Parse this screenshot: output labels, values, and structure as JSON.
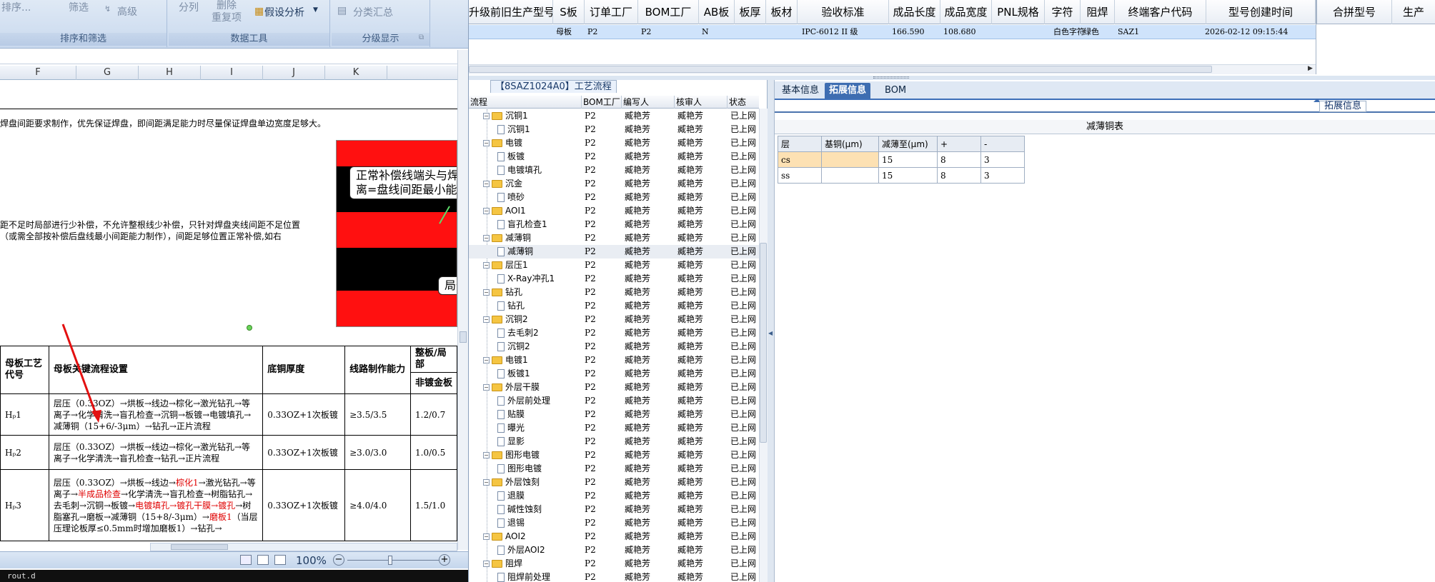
{
  "ribbon": {
    "sort_label": "排序...",
    "filter_label": "筛选",
    "advanced_label": "高级",
    "group_sort_filter": "排序和筛选",
    "split_label": "分列",
    "remove_dup_label": "删除\n重复项",
    "whatif_label": "假设分析",
    "group_data_tools": "数据工具",
    "subtotal_label": "分类汇总",
    "group_outline": "分级显示"
  },
  "sheet": {
    "columns": [
      "F",
      "G",
      "H",
      "I",
      "J",
      "K"
    ],
    "line1": "焊盘间距要求制作，优先保证焊盘，即间距满足能力时尽量保证焊盘单边宽度足够大。",
    "line2": "距不足时局部进行少补偿，不允许整根线少补偿，只针对焊盘夹线间距不足位置",
    "line3": "（或需全部按补偿后盘线最小间距能力制作），间距足够位置正常补偿,如右",
    "callout1a": "正常补偿线端头与焊",
    "callout1b": "离=盘线间距最小能",
    "callout2": "局部",
    "zoom": "100%",
    "taskbar_text": "rout.d",
    "table": {
      "headers": [
        "母板工艺\n代号",
        "母板关键流程设置",
        "底铜厚度",
        "线路制作能力",
        "整板/局部"
      ],
      "subheader": "非镀金板",
      "rows": [
        {
          "code": "Hₚ1",
          "flow": "层压（0.33OZ）→烘板→线边→棕化→激光钻孔→等离子→化学清洗→盲孔检查→沉铜→板镀→电镀填孔→减薄铜（15+6/-3μm）→钻孔→正片流程",
          "copper": "0.33OZ+1次板镀",
          "ability": "≥3.5/3.5",
          "ratio": "1.2/0.7"
        },
        {
          "code": "Hₚ2",
          "flow": "层压（0.33OZ）→烘板→线边→棕化→激光钻孔→等离子→化学清洗→盲孔检查→钻孔→正片流程",
          "copper": "0.33OZ+1次板镀",
          "ability": "≥3.0/3.0",
          "ratio": "1.0/0.5"
        },
        {
          "code": "Hₚ3",
          "flow_a": "层压（0.33OZ）→烘板→线边→",
          "flow_red1": "棕化1",
          "flow_b": "→激光钻孔→等离子→",
          "flow_red2": "半成品检查",
          "flow_c": "→化学清洗→盲孔检查→树脂钻孔→去毛刺→沉铜→板镀→",
          "flow_red3": "电镀填孔→镀孔干膜→镀孔",
          "flow_d": "→树脂塞孔→磨板→减薄铜（15+8/-3μm）→",
          "flow_red4": "磨板1",
          "flow_e": "（当层压理论板厚≤0.5mm时增加磨板1）→钻孔→",
          "copper": "0.33OZ+1次板镀",
          "ability": "≥4.0/4.0",
          "ratio": "1.5/1.0"
        }
      ]
    }
  },
  "grid": {
    "columns": [
      "升级前旧生产型号",
      "S板",
      "订单工厂",
      "BOM工厂",
      "AB板",
      "板厚",
      "板材",
      "验收标准",
      "成品长度",
      "成品宽度",
      "PNL规格",
      "字符",
      "阻焊",
      "终端客户代码",
      "型号创建时间",
      "合拼型号",
      "生产"
    ],
    "row": {
      "s": "母板",
      "order_factory": "P2",
      "bom_factory": "P2",
      "ab": "N",
      "standard": "IPC-6012 II 级",
      "length": "166.590",
      "width": "108.680",
      "char": "白色字符",
      "mask": "绿色",
      "customer": "SAZ1",
      "created": "2026-02-12 09:15:44"
    }
  },
  "process": {
    "title": "【8SAZ1024A0】工艺流程",
    "headers": [
      "流程",
      "BOM工厂",
      "编写人",
      "核审人",
      "状态"
    ],
    "rows": [
      {
        "lvl": 0,
        "name": "沉铜1",
        "bom": "P2",
        "w": "臧艳芳",
        "r": "臧艳芳",
        "s": "已上网"
      },
      {
        "lvl": 1,
        "name": "沉铜1",
        "bom": "P2",
        "w": "臧艳芳",
        "r": "臧艳芳",
        "s": "已上网"
      },
      {
        "lvl": 0,
        "name": "电镀",
        "bom": "P2",
        "w": "臧艳芳",
        "r": "臧艳芳",
        "s": "已上网"
      },
      {
        "lvl": 1,
        "name": "板镀",
        "bom": "P2",
        "w": "臧艳芳",
        "r": "臧艳芳",
        "s": "已上网"
      },
      {
        "lvl": 1,
        "name": "电镀填孔",
        "bom": "P2",
        "w": "臧艳芳",
        "r": "臧艳芳",
        "s": "已上网"
      },
      {
        "lvl": 0,
        "name": "沉金",
        "bom": "P2",
        "w": "臧艳芳",
        "r": "臧艳芳",
        "s": "已上网"
      },
      {
        "lvl": 1,
        "name": "喷砂",
        "bom": "P2",
        "w": "臧艳芳",
        "r": "臧艳芳",
        "s": "已上网"
      },
      {
        "lvl": 0,
        "name": "AOI1",
        "bom": "P2",
        "w": "臧艳芳",
        "r": "臧艳芳",
        "s": "已上网"
      },
      {
        "lvl": 1,
        "name": "盲孔检查1",
        "bom": "P2",
        "w": "臧艳芳",
        "r": "臧艳芳",
        "s": "已上网"
      },
      {
        "lvl": 0,
        "name": "减薄铜",
        "bom": "P2",
        "w": "臧艳芳",
        "r": "臧艳芳",
        "s": "已上网"
      },
      {
        "lvl": 1,
        "name": "减薄铜",
        "bom": "P2",
        "w": "臧艳芳",
        "r": "臧艳芳",
        "s": "已上网",
        "sel": true
      },
      {
        "lvl": 0,
        "name": "层压1",
        "bom": "P2",
        "w": "臧艳芳",
        "r": "臧艳芳",
        "s": "已上网"
      },
      {
        "lvl": 1,
        "name": "X-Ray冲孔1",
        "bom": "P2",
        "w": "臧艳芳",
        "r": "臧艳芳",
        "s": "已上网"
      },
      {
        "lvl": 0,
        "name": "钻孔",
        "bom": "P2",
        "w": "臧艳芳",
        "r": "臧艳芳",
        "s": "已上网"
      },
      {
        "lvl": 1,
        "name": "钻孔",
        "bom": "P2",
        "w": "臧艳芳",
        "r": "臧艳芳",
        "s": "已上网"
      },
      {
        "lvl": 0,
        "name": "沉铜2",
        "bom": "P2",
        "w": "臧艳芳",
        "r": "臧艳芳",
        "s": "已上网"
      },
      {
        "lvl": 1,
        "name": "去毛刺2",
        "bom": "P2",
        "w": "臧艳芳",
        "r": "臧艳芳",
        "s": "已上网"
      },
      {
        "lvl": 1,
        "name": "沉铜2",
        "bom": "P2",
        "w": "臧艳芳",
        "r": "臧艳芳",
        "s": "已上网"
      },
      {
        "lvl": 0,
        "name": "电镀1",
        "bom": "P2",
        "w": "臧艳芳",
        "r": "臧艳芳",
        "s": "已上网"
      },
      {
        "lvl": 1,
        "name": "板镀1",
        "bom": "P2",
        "w": "臧艳芳",
        "r": "臧艳芳",
        "s": "已上网"
      },
      {
        "lvl": 0,
        "name": "外层干膜",
        "bom": "P2",
        "w": "臧艳芳",
        "r": "臧艳芳",
        "s": "已上网"
      },
      {
        "lvl": 1,
        "name": "外层前处理",
        "bom": "P2",
        "w": "臧艳芳",
        "r": "臧艳芳",
        "s": "已上网"
      },
      {
        "lvl": 1,
        "name": "贴膜",
        "bom": "P2",
        "w": "臧艳芳",
        "r": "臧艳芳",
        "s": "已上网"
      },
      {
        "lvl": 1,
        "name": "曝光",
        "bom": "P2",
        "w": "臧艳芳",
        "r": "臧艳芳",
        "s": "已上网"
      },
      {
        "lvl": 1,
        "name": "显影",
        "bom": "P2",
        "w": "臧艳芳",
        "r": "臧艳芳",
        "s": "已上网"
      },
      {
        "lvl": 0,
        "name": "图形电镀",
        "bom": "P2",
        "w": "臧艳芳",
        "r": "臧艳芳",
        "s": "已上网"
      },
      {
        "lvl": 1,
        "name": "图形电镀",
        "bom": "P2",
        "w": "臧艳芳",
        "r": "臧艳芳",
        "s": "已上网"
      },
      {
        "lvl": 0,
        "name": "外层蚀刻",
        "bom": "P2",
        "w": "臧艳芳",
        "r": "臧艳芳",
        "s": "已上网"
      },
      {
        "lvl": 1,
        "name": "退膜",
        "bom": "P2",
        "w": "臧艳芳",
        "r": "臧艳芳",
        "s": "已上网"
      },
      {
        "lvl": 1,
        "name": "碱性蚀刻",
        "bom": "P2",
        "w": "臧艳芳",
        "r": "臧艳芳",
        "s": "已上网"
      },
      {
        "lvl": 1,
        "name": "退锡",
        "bom": "P2",
        "w": "臧艳芳",
        "r": "臧艳芳",
        "s": "已上网"
      },
      {
        "lvl": 0,
        "name": "AOI2",
        "bom": "P2",
        "w": "臧艳芳",
        "r": "臧艳芳",
        "s": "已上网"
      },
      {
        "lvl": 1,
        "name": "外层AOI2",
        "bom": "P2",
        "w": "臧艳芳",
        "r": "臧艳芳",
        "s": "已上网"
      },
      {
        "lvl": 0,
        "name": "阻焊",
        "bom": "P2",
        "w": "臧艳芳",
        "r": "臧艳芳",
        "s": "已上网"
      },
      {
        "lvl": 1,
        "name": "阻焊前处理",
        "bom": "P2",
        "w": "臧艳芳",
        "r": "臧艳芳",
        "s": "已上网"
      }
    ]
  },
  "detail": {
    "tabs": [
      "基本信息",
      "拓展信息",
      "BOM"
    ],
    "active_tab": 1,
    "section": "拓展信息",
    "subtitle": "减薄铜表",
    "table_headers": [
      "层",
      "基铜(μm)",
      "减薄至(μm)",
      "+",
      "-"
    ],
    "table_rows": [
      [
        "cs",
        "",
        "15",
        "8",
        "3"
      ],
      [
        "ss",
        "",
        "15",
        "8",
        "3"
      ]
    ]
  }
}
